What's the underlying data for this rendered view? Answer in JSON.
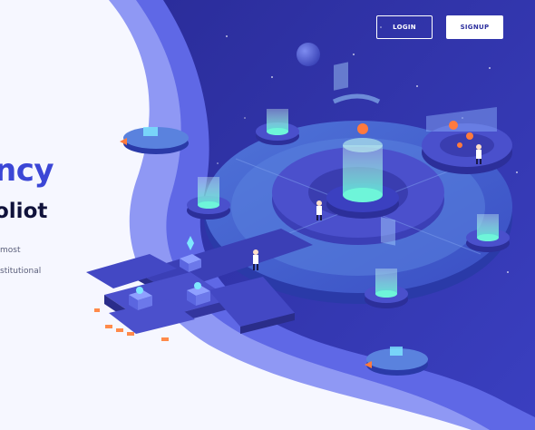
{
  "header": {
    "login_label": "LOGIN",
    "signup_label": "SIGNUP"
  },
  "hero": {
    "title_fragment": "ncy",
    "subtitle_fragment": "oliot",
    "body_fragment_1": "most",
    "body_fragment_2": "stitutional"
  },
  "colors": {
    "background_deep": "#2e31a8",
    "wave_light": "#6f78ee",
    "wave_mid": "#4a52d8",
    "accent_teal": "#5ef0d4",
    "accent_orange": "#ff7a3d",
    "title_blue": "#3b46d6",
    "title_dark": "#10123a"
  },
  "icons": [
    "planet-icon",
    "person-figure-icon",
    "data-cylinder-icon",
    "hover-ship-icon"
  ]
}
